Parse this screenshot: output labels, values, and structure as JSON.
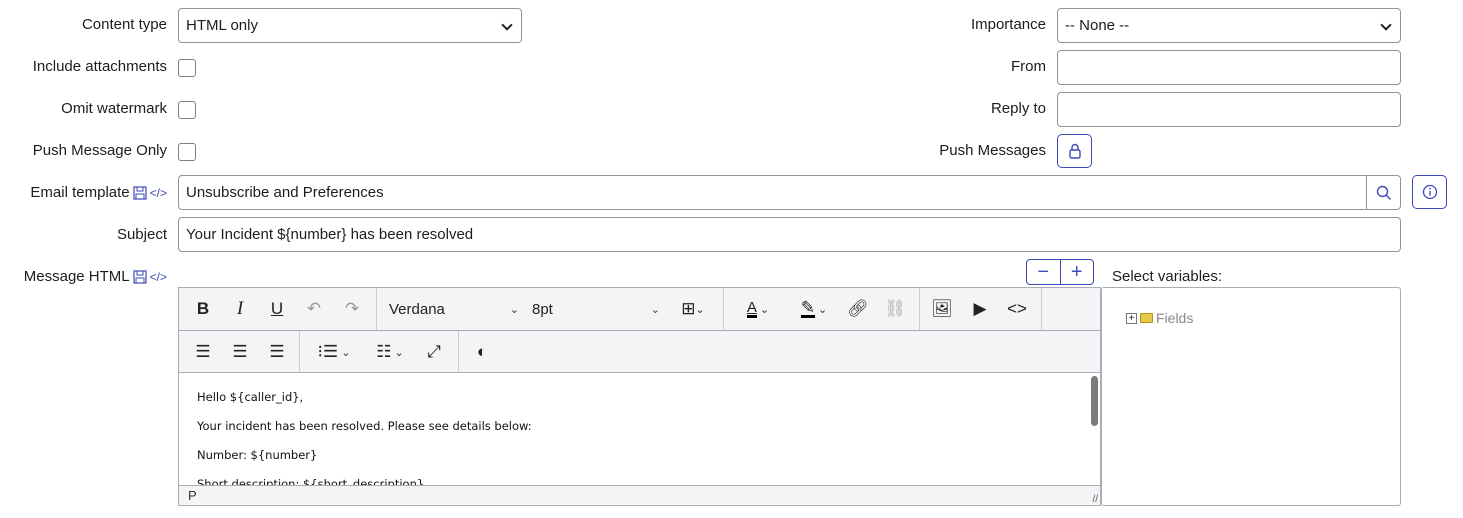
{
  "fields": {
    "content_type": {
      "label": "Content type",
      "value": "HTML only"
    },
    "include_attachments": {
      "label": "Include attachments",
      "checked": false
    },
    "omit_watermark": {
      "label": "Omit watermark",
      "checked": false
    },
    "push_message_only": {
      "label": "Push Message Only",
      "checked": false
    },
    "importance": {
      "label": "Importance",
      "value": "-- None --"
    },
    "from": {
      "label": "From",
      "value": ""
    },
    "reply_to": {
      "label": "Reply to",
      "value": ""
    },
    "push_messages": {
      "label": "Push Messages"
    },
    "email_template": {
      "label": "Email template",
      "value": "Unsubscribe and Preferences"
    },
    "subject": {
      "label": "Subject",
      "value": "Your Incident ${number} has been resolved"
    },
    "message_html": {
      "label": "Message HTML"
    }
  },
  "editor": {
    "font": "Verdana",
    "size": "8pt",
    "content": [
      "Hello ${caller_id},",
      "Your incident has been resolved. Please see details below:",
      "Number: ${number}",
      "Short description: ${short_description}"
    ],
    "status_path": "P"
  },
  "variables": {
    "label": "Select variables:",
    "tree": [
      {
        "label": "Fields",
        "expand": "+"
      }
    ]
  },
  "colors": {
    "accent": "#3c4bb8",
    "border": "#8e939c",
    "toolbar_bg": "#f4f4f6"
  }
}
